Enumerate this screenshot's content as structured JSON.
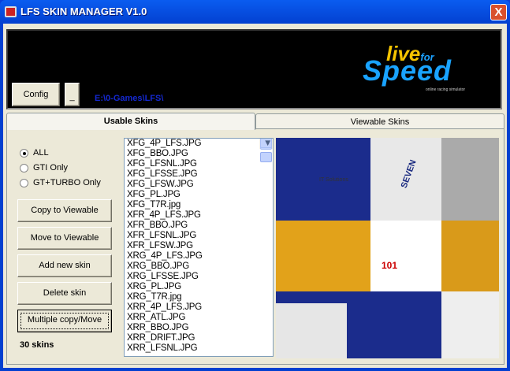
{
  "window": {
    "title": "LFS SKIN MANAGER V1.0",
    "close": "X"
  },
  "banner": {
    "config_label": "Config",
    "minimize_label": "_",
    "path": "E:\\0-Games\\LFS\\",
    "logo": {
      "line1": "live",
      "for": "for",
      "line2": "Speed",
      "tagline": "online racing simulator"
    }
  },
  "tabs": [
    {
      "label": "Usable Skins",
      "active": true
    },
    {
      "label": "Viewable Skins",
      "active": false
    }
  ],
  "filters": [
    {
      "label": "ALL",
      "checked": true
    },
    {
      "label": "GTI Only",
      "checked": false
    },
    {
      "label": "GT+TURBO Only",
      "checked": false
    }
  ],
  "actions": [
    "Copy to Viewable",
    "Move to Viewable",
    "Add new skin",
    "Delete skin",
    "Multiple copy/Move"
  ],
  "skin_count": "30 skins",
  "skins": [
    "XFG_4P_LFS.JPG",
    "XFG_BBO.JPG",
    "XFG_LFSNL.JPG",
    "XFG_LFSSE.JPG",
    "XFG_LFSW.JPG",
    "XFG_PL.JPG",
    "XFG_T7R.jpg",
    "XFR_4P_LFS.JPG",
    "XFR_BBO.JPG",
    "XFR_LFSNL.JPG",
    "XFR_LFSW.JPG",
    "XRG_4P_LFS.JPG",
    "XRG_BBO.JPG",
    "XRG_LFSSE.JPG",
    "XRG_PL.JPG",
    "XRG_T7R.jpg",
    "XRR_4P_LFS.JPG",
    "XRR_ATL.JPG",
    "XRR_BBO.JPG",
    "XRR_DRIFT.JPG",
    "XRR_LFSNL.JPG"
  ],
  "preview": {
    "texts": [
      "IT Solutions",
      "SEVEN",
      "101"
    ]
  }
}
